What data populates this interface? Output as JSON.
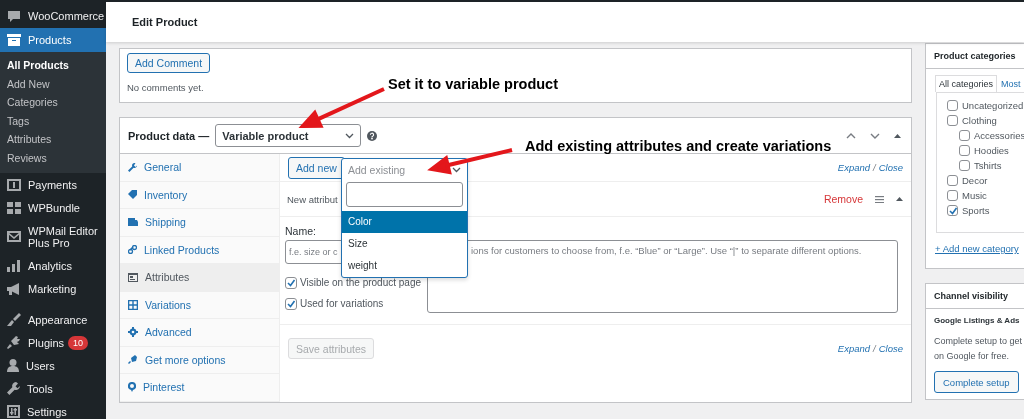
{
  "sidebar": {
    "items": [
      {
        "label": "WooCommerce",
        "selected": false
      },
      {
        "label": "Products",
        "selected": true,
        "children": [
          {
            "label": "All Products",
            "selected": true
          },
          {
            "label": "Add New",
            "selected": false
          },
          {
            "label": "Categories",
            "selected": false
          },
          {
            "label": "Tags",
            "selected": false
          },
          {
            "label": "Attributes",
            "selected": false
          },
          {
            "label": "Reviews",
            "selected": false
          }
        ]
      },
      {
        "label": "Payments",
        "selected": false
      },
      {
        "label": "WPBundle",
        "selected": false
      },
      {
        "label": "WPMail Editor Plus Pro",
        "selected": false
      },
      {
        "label": "Analytics",
        "selected": false
      },
      {
        "label": "Marketing",
        "selected": false
      },
      {
        "label": "Appearance",
        "selected": false
      },
      {
        "label": "Plugins",
        "selected": false,
        "badge": "10"
      },
      {
        "label": "Users",
        "selected": false
      },
      {
        "label": "Tools",
        "selected": false
      },
      {
        "label": "Settings",
        "selected": false
      }
    ]
  },
  "header": {
    "title": "Edit Product"
  },
  "comments": {
    "button": "Add Comment",
    "message": "No comments yet."
  },
  "product_data": {
    "label": "Product data —",
    "product_type": "Variable product",
    "tabs": [
      {
        "label": "General",
        "selected": false
      },
      {
        "label": "Inventory",
        "selected": false
      },
      {
        "label": "Shipping",
        "selected": false
      },
      {
        "label": "Linked Products",
        "selected": false
      },
      {
        "label": "Attributes",
        "selected": true
      },
      {
        "label": "Variations",
        "selected": false
      },
      {
        "label": "Advanced",
        "selected": false
      },
      {
        "label": "Get more options",
        "selected": false
      },
      {
        "label": "Pinterest",
        "selected": false
      }
    ],
    "attributes": {
      "add_new": "Add new",
      "add_existing": {
        "placeholder": "Add existing",
        "expanded": true,
        "options": [
          {
            "label": "Color",
            "selected": true
          },
          {
            "label": "Size",
            "selected": false
          },
          {
            "label": "weight",
            "selected": false
          }
        ]
      },
      "expand": "Expand",
      "separator": "/",
      "close": "Close",
      "attribute": {
        "title": "New attribut",
        "remove": "Remove",
        "name_label": "Name:",
        "name_placeholder": "f.e. size or c",
        "values_placeholder": "ions for customers to choose from, f.e. “Blue” or “Large”. Use “|” to separate different options.",
        "options": [
          {
            "label": "Visible on the product page",
            "checked": true
          },
          {
            "label": "Used for variations",
            "checked": true
          }
        ]
      },
      "save_button": {
        "label": "Save attributes",
        "disabled": true
      },
      "footer_expand": "Expand",
      "footer_separator": "/",
      "footer_close": "Close"
    }
  },
  "categories": {
    "title": "Product categories",
    "tabs": [
      {
        "label": "All categories",
        "selected": true
      },
      {
        "label": "Most",
        "selected": false
      }
    ],
    "items": [
      {
        "label": "Uncategorized",
        "checked": false
      },
      {
        "label": "Clothing",
        "checked": false,
        "children": [
          {
            "label": "Accessories",
            "checked": false
          },
          {
            "label": "Hoodies",
            "checked": false
          },
          {
            "label": "Tshirts",
            "checked": false
          }
        ]
      },
      {
        "label": "Decor",
        "checked": false
      },
      {
        "label": "Music",
        "checked": false
      },
      {
        "label": "Sports",
        "checked": true
      }
    ],
    "add_link": "+ Add new category"
  },
  "channel": {
    "title": "Channel visibility",
    "subtitle": "Google Listings & Ads",
    "lines": [
      "Complete setup to get",
      "on Google for free."
    ],
    "button": "Complete setup"
  },
  "annotations": [
    {
      "text": "Set it to variable product"
    },
    {
      "text": "Add existing attributes and create variations"
    }
  ]
}
